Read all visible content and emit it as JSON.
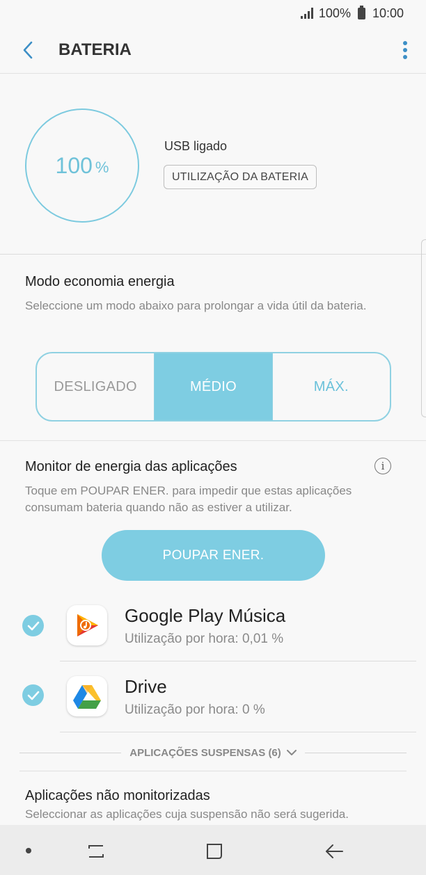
{
  "status_bar": {
    "battery_pct": "100%",
    "time": "10:00"
  },
  "header": {
    "title": "BATERIA",
    "back_icon": "chevron-left-icon",
    "more_icon": "more-vertical-icon"
  },
  "battery": {
    "level_value": "100",
    "level_unit": "%",
    "connection_status": "USB ligado",
    "usage_button_label": "UTILIZAÇÃO DA BATERIA",
    "accent_color": "#7ccadf"
  },
  "power_mode": {
    "title": "Modo economia energia",
    "description": "Seleccione um modo abaixo para prolongar a vida útil da bateria.",
    "options": [
      {
        "label": "DESLIGADO",
        "selected": false
      },
      {
        "label": "MÉDIO",
        "selected": true
      },
      {
        "label": "MÁX.",
        "selected": false
      }
    ]
  },
  "app_monitor": {
    "title": "Monitor de energia das aplicações",
    "description": "Toque em POUPAR ENER. para impedir que estas aplicações consumam bateria quando não as estiver a utilizar.",
    "save_button_label": "POUPAR ENER.",
    "apps": [
      {
        "name": "Google Play Música",
        "usage": "Utilização por hora: 0,01 %",
        "checked": true,
        "icon": "google-play-music-icon"
      },
      {
        "name": "Drive",
        "usage": "Utilização por hora: 0 %",
        "checked": true,
        "icon": "google-drive-icon"
      }
    ],
    "suspended_label": "APLICAÇÕES SUSPENSAS (6)"
  },
  "unmonitored": {
    "title": "Aplicações não monitorizadas",
    "description": "Seleccionar as aplicações cuja suspensão não será sugerida."
  },
  "nav_bar": {
    "icons": [
      "recents-icon",
      "home-icon",
      "back-icon"
    ]
  }
}
